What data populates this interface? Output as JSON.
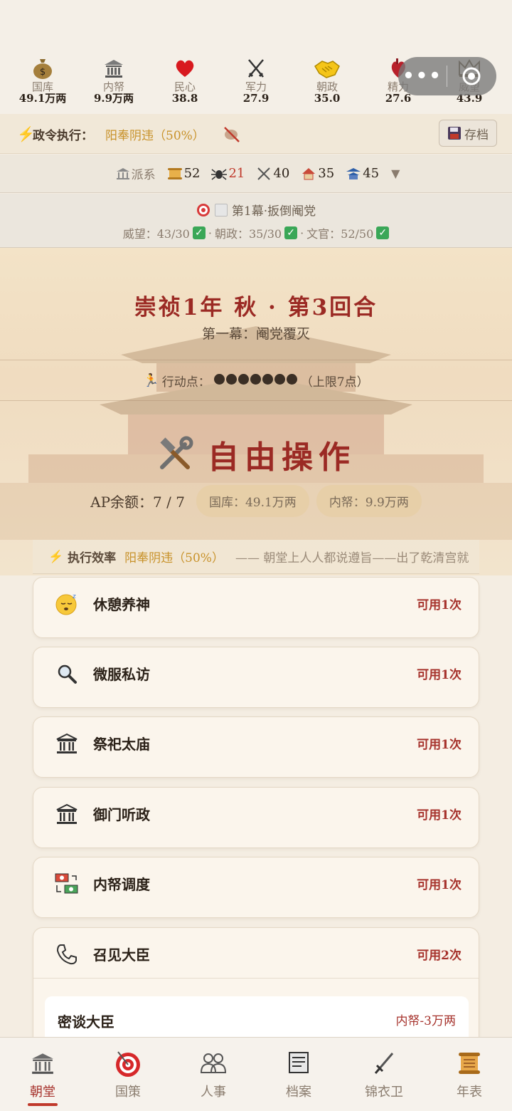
{
  "stats": [
    {
      "icon": "money-bag-icon",
      "label": "国库",
      "value": "49.1万两"
    },
    {
      "icon": "bank-icon",
      "label": "内帑",
      "value": "9.9万两"
    },
    {
      "icon": "heart-icon",
      "label": "民心",
      "value": "38.8"
    },
    {
      "icon": "crossed-swords-icon",
      "label": "军力",
      "value": "27.9"
    },
    {
      "icon": "handshake-icon",
      "label": "朝政",
      "value": "35.0"
    },
    {
      "icon": "anatomical-heart-icon",
      "label": "精力",
      "value": "27.6"
    },
    {
      "icon": "crown-icon",
      "label": "威望",
      "value": "43.9"
    }
  ],
  "decree": {
    "label": "政令执行：",
    "value": "阳奉阴违（50%）"
  },
  "save_label": "存档",
  "faction": {
    "label": "派系",
    "items": [
      {
        "icon": "scroll-icon",
        "value": "52"
      },
      {
        "icon": "spider-icon",
        "value": "21"
      },
      {
        "icon": "crossed-swords-icon",
        "value": "40"
      },
      {
        "icon": "house-icon",
        "value": "35"
      },
      {
        "icon": "pagoda-icon",
        "value": "45"
      }
    ]
  },
  "objective": {
    "title": "第1幕·扳倒阉党",
    "conditions": [
      "威望：43/30",
      "朝政：35/30",
      "文官：52/50"
    ],
    "sep": "·"
  },
  "turn": "崇祯1年 秋 · 第3回合",
  "act": "第一幕：阉党覆灭",
  "action_points": {
    "label": "行动点：",
    "filled": 7,
    "cap": "（上限7点）"
  },
  "mode_title": "自由操作",
  "balance": {
    "ap": "AP余额：7 / 7",
    "treasury": "国库：49.1万两",
    "privy": "内帑：9.9万两"
  },
  "efficiency": {
    "label": "执行效率",
    "value": "阳奉阴违（50%）",
    "note": "—— 朝堂上人人都说遵旨——出了乾清宫就"
  },
  "actions": [
    {
      "icon": "sleeping-face-icon",
      "name": "休憩养神",
      "uses": "可用1次"
    },
    {
      "icon": "magnifier-icon",
      "name": "微服私访",
      "uses": "可用1次"
    },
    {
      "icon": "temple-icon",
      "name": "祭祀太庙",
      "uses": "可用1次"
    },
    {
      "icon": "temple-icon",
      "name": "御门听政",
      "uses": "可用1次"
    },
    {
      "icon": "money-transfer-icon",
      "name": "内帑调度",
      "uses": "可用1次"
    },
    {
      "icon": "phone-icon",
      "name": "召见大臣",
      "uses": "可用2次"
    }
  ],
  "sub_action": {
    "name": "密谈大臣",
    "cost": "内帑-3万两"
  },
  "tabs": [
    {
      "icon": "temple-icon",
      "label": "朝堂"
    },
    {
      "icon": "target-icon",
      "label": "国策"
    },
    {
      "icon": "people-icon",
      "label": "人事"
    },
    {
      "icon": "document-icon",
      "label": "档案"
    },
    {
      "icon": "dagger-icon",
      "label": "锦衣卫"
    },
    {
      "icon": "scroll-icon",
      "label": "年表"
    }
  ],
  "colors": {
    "accent": "#9b2a24",
    "gold": "#c8922a",
    "active_tab": "#c0392b"
  }
}
